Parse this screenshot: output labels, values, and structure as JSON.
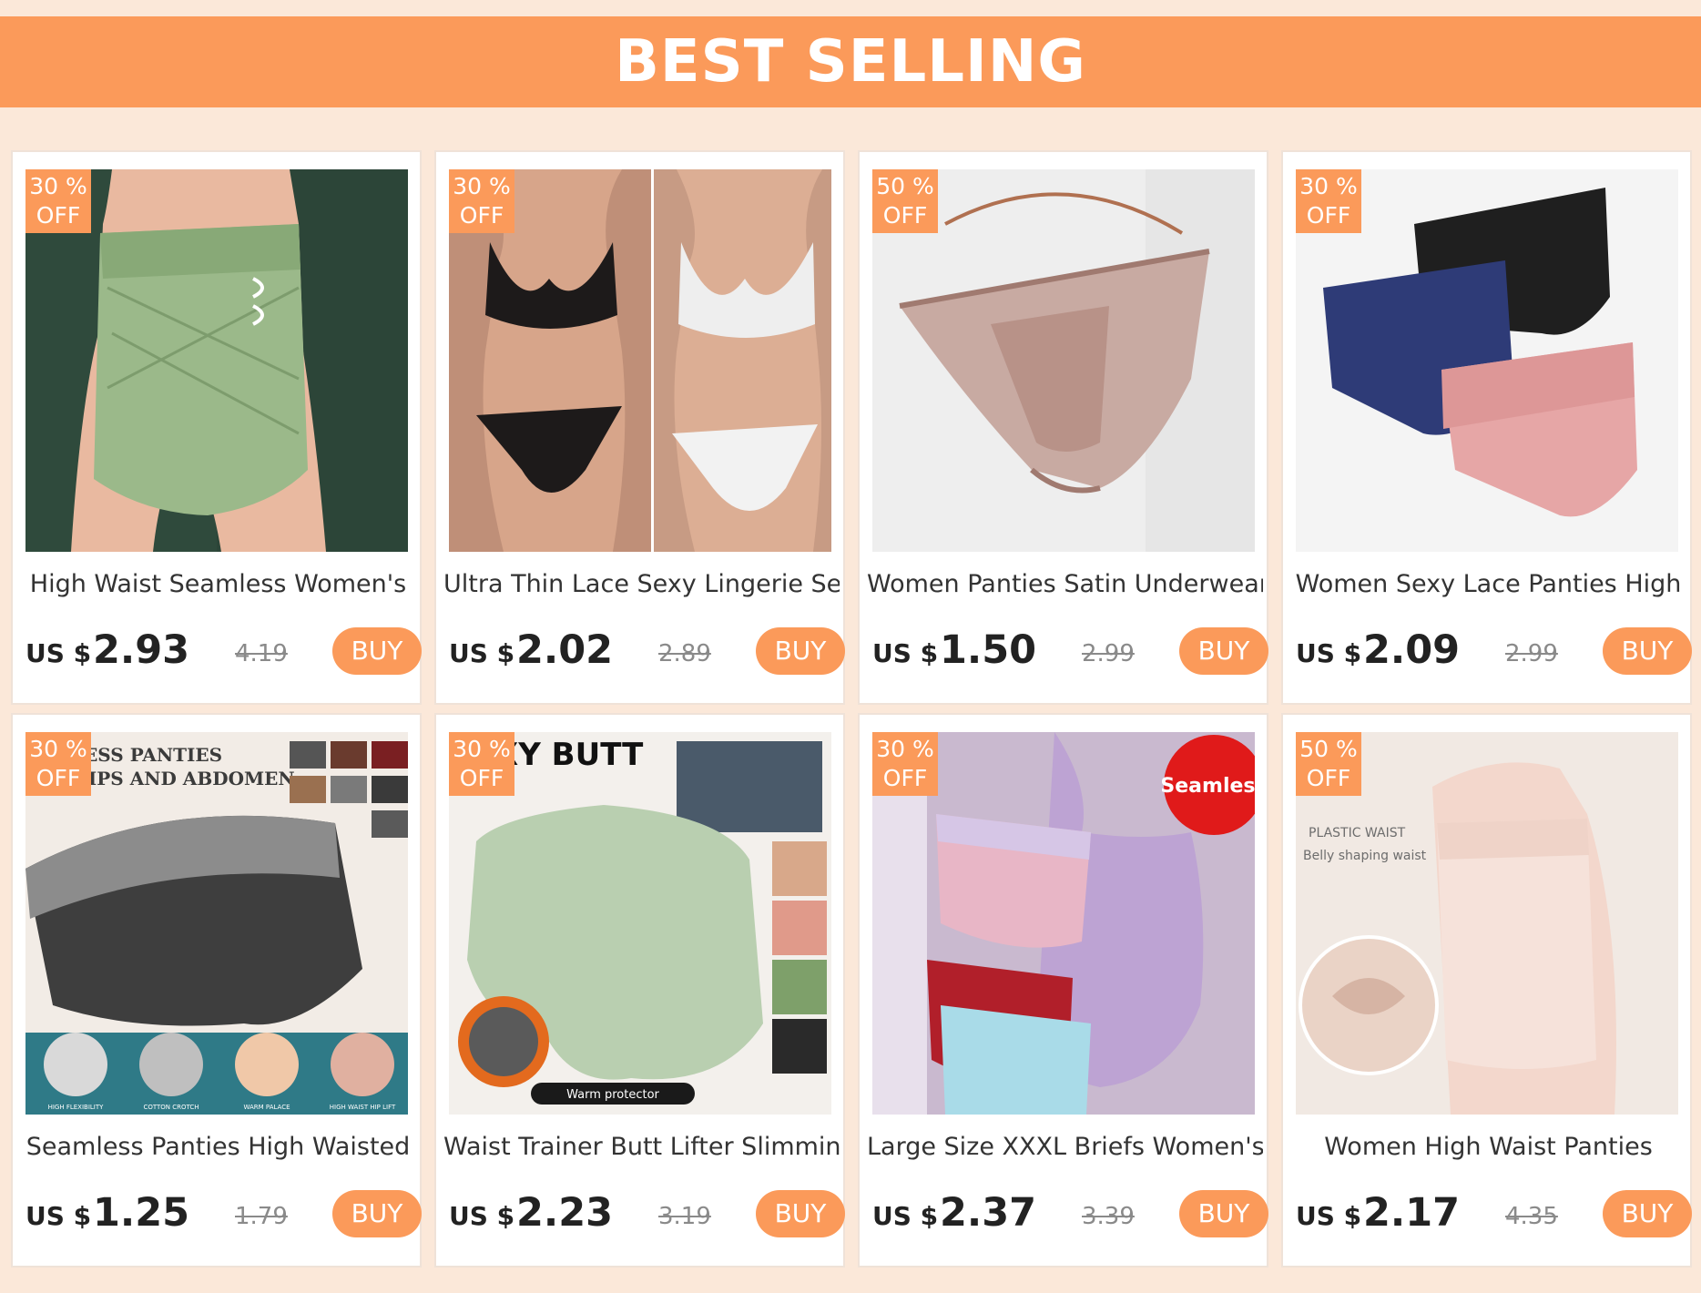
{
  "banner": {
    "title": "BEST SELLING"
  },
  "products": [
    {
      "discount": "30 %",
      "off": "OFF",
      "title": "High Waist Seamless Women's",
      "currency": "US $",
      "price": "2.93",
      "old_price": "4.19",
      "buy": "BUY"
    },
    {
      "discount": "30 %",
      "off": "OFF",
      "title": "Ultra Thin Lace Sexy Lingerie Set",
      "currency": "US $",
      "price": "2.02",
      "old_price": "2.89",
      "buy": "BUY"
    },
    {
      "discount": "50 %",
      "off": "OFF",
      "title": "Women Panties Satin Underwear",
      "currency": "US $",
      "price": "1.50",
      "old_price": "2.99",
      "buy": "BUY"
    },
    {
      "discount": "30 %",
      "off": "OFF",
      "title": "Women Sexy Lace Panties High",
      "currency": "US $",
      "price": "2.09",
      "old_price": "2.99",
      "buy": "BUY"
    },
    {
      "discount": "30 %",
      "off": "OFF",
      "title": "Seamless Panties High Waisted",
      "currency": "US $",
      "price": "1.25",
      "old_price": "1.79",
      "buy": "BUY"
    },
    {
      "discount": "30 %",
      "off": "OFF",
      "title": "Waist Trainer Butt Lifter Slimming",
      "currency": "US $",
      "price": "2.23",
      "old_price": "3.19",
      "buy": "BUY"
    },
    {
      "discount": "30 %",
      "off": "OFF",
      "title": "Large Size XXXL Briefs Women's",
      "currency": "US $",
      "price": "2.37",
      "old_price": "3.39",
      "buy": "BUY"
    },
    {
      "discount": "50 %",
      "off": "OFF",
      "title": "Women High Waist Panties",
      "currency": "US $",
      "price": "2.17",
      "old_price": "4.35",
      "buy": "BUY"
    }
  ],
  "image_text": {
    "p5_heading1": "LESS PANTIES",
    "p5_heading2": "HIPS AND ABDOMEN",
    "p5_labels": [
      "HIGH FLEXIBILITY",
      "COTTON CROTCH",
      "WARM PALACE",
      "HIGH WAIST HIP LIFT"
    ],
    "p6_heading": "XY BUTT",
    "p6_caption": "Warm protector",
    "p7_sticker": "Seamless",
    "p8_line1": "PLASTIC WAIST",
    "p8_line2": "Belly shaping waist"
  },
  "colors": {
    "accent": "#fb9a5a",
    "background": "#fbe8d9"
  }
}
